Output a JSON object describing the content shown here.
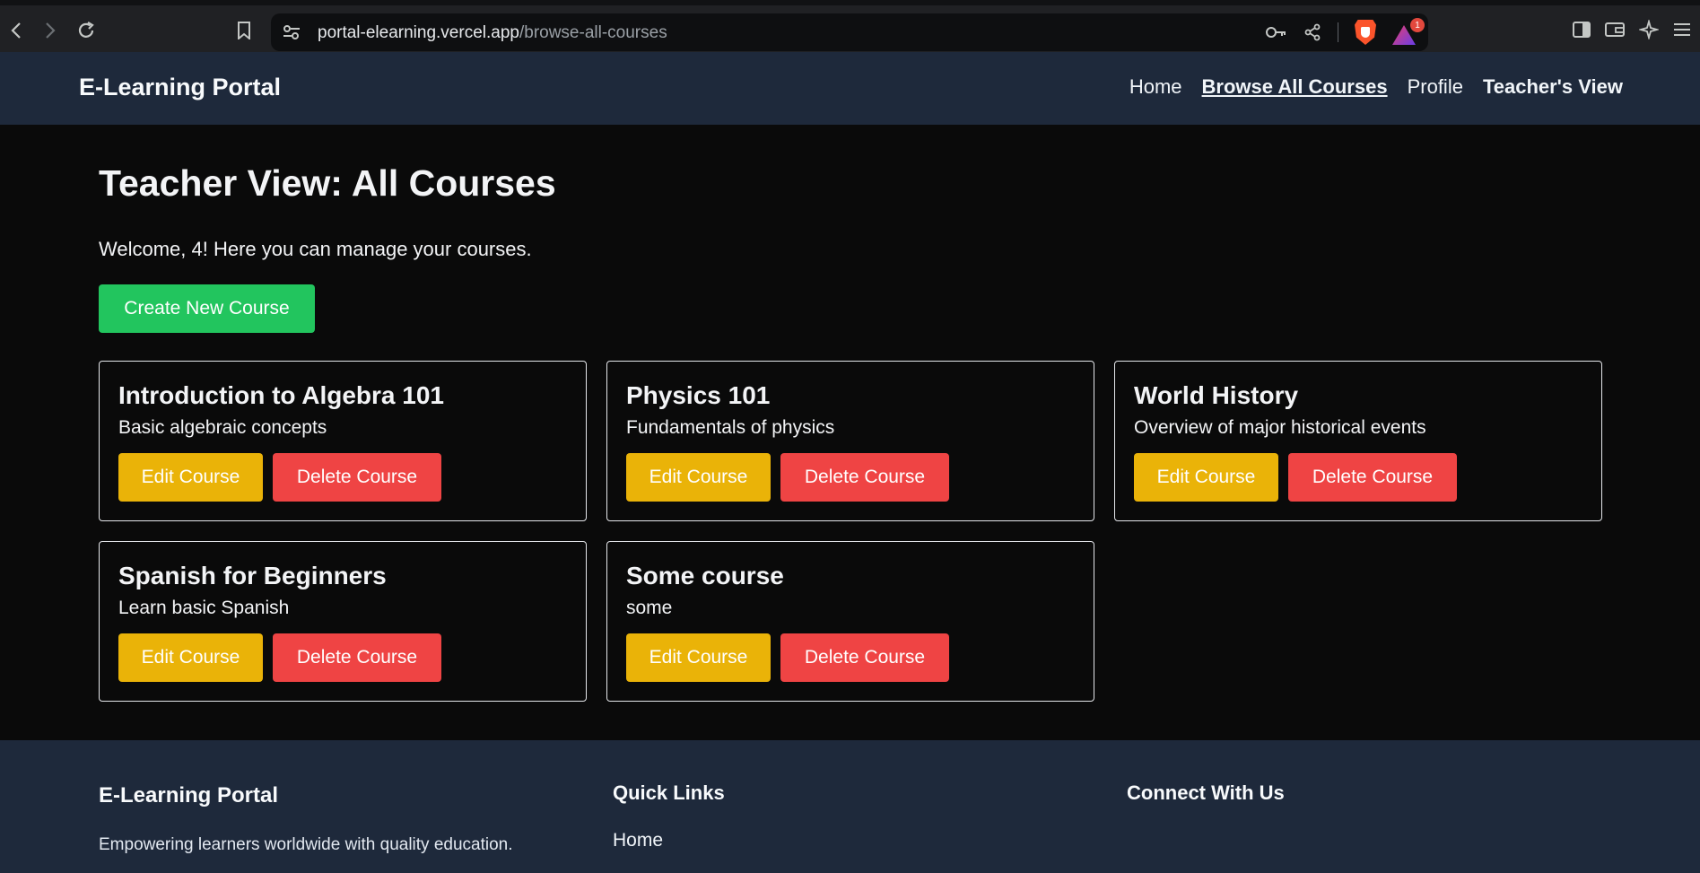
{
  "browser": {
    "url_host": "portal-elearning.vercel.app",
    "url_path": "/browse-all-courses",
    "rewards_badge": "1",
    "icons": [
      "back-icon",
      "forward-icon",
      "reload-icon",
      "bookmark-icon",
      "site-settings-icon",
      "key-icon",
      "share-icon",
      "brave-shields-icon",
      "brave-rewards-icon",
      "sidebar-icon",
      "wallet-icon",
      "leo-ai-icon",
      "menu-icon"
    ]
  },
  "header": {
    "brand": "E-Learning Portal",
    "nav": [
      {
        "label": "Home"
      },
      {
        "label": "Browse All Courses"
      },
      {
        "label": "Profile"
      },
      {
        "label": "Teacher's View"
      }
    ]
  },
  "main": {
    "title": "Teacher View: All Courses",
    "welcome": "Welcome, 4! Here you can manage your courses.",
    "create_label": "Create New Course",
    "edit_label": "Edit Course",
    "delete_label": "Delete Course",
    "courses": [
      {
        "title": "Introduction to Algebra 101",
        "description": "Basic algebraic concepts"
      },
      {
        "title": "Physics 101",
        "description": "Fundamentals of physics"
      },
      {
        "title": "World History",
        "description": "Overview of major historical events"
      },
      {
        "title": "Spanish for Beginners",
        "description": "Learn basic Spanish"
      },
      {
        "title": "Some course",
        "description": "some"
      }
    ]
  },
  "footer": {
    "brand": "E-Learning Portal",
    "tagline": "Empowering learners worldwide with quality education.",
    "quick_links_title": "Quick Links",
    "quick_links": [
      "Home"
    ],
    "connect_title": "Connect With Us"
  },
  "colors": {
    "header_bg": "#1e293b",
    "page_bg": "#0a0a0a",
    "create_button": "#22c55e",
    "edit_button": "#eab308",
    "delete_button": "#ef4444"
  }
}
